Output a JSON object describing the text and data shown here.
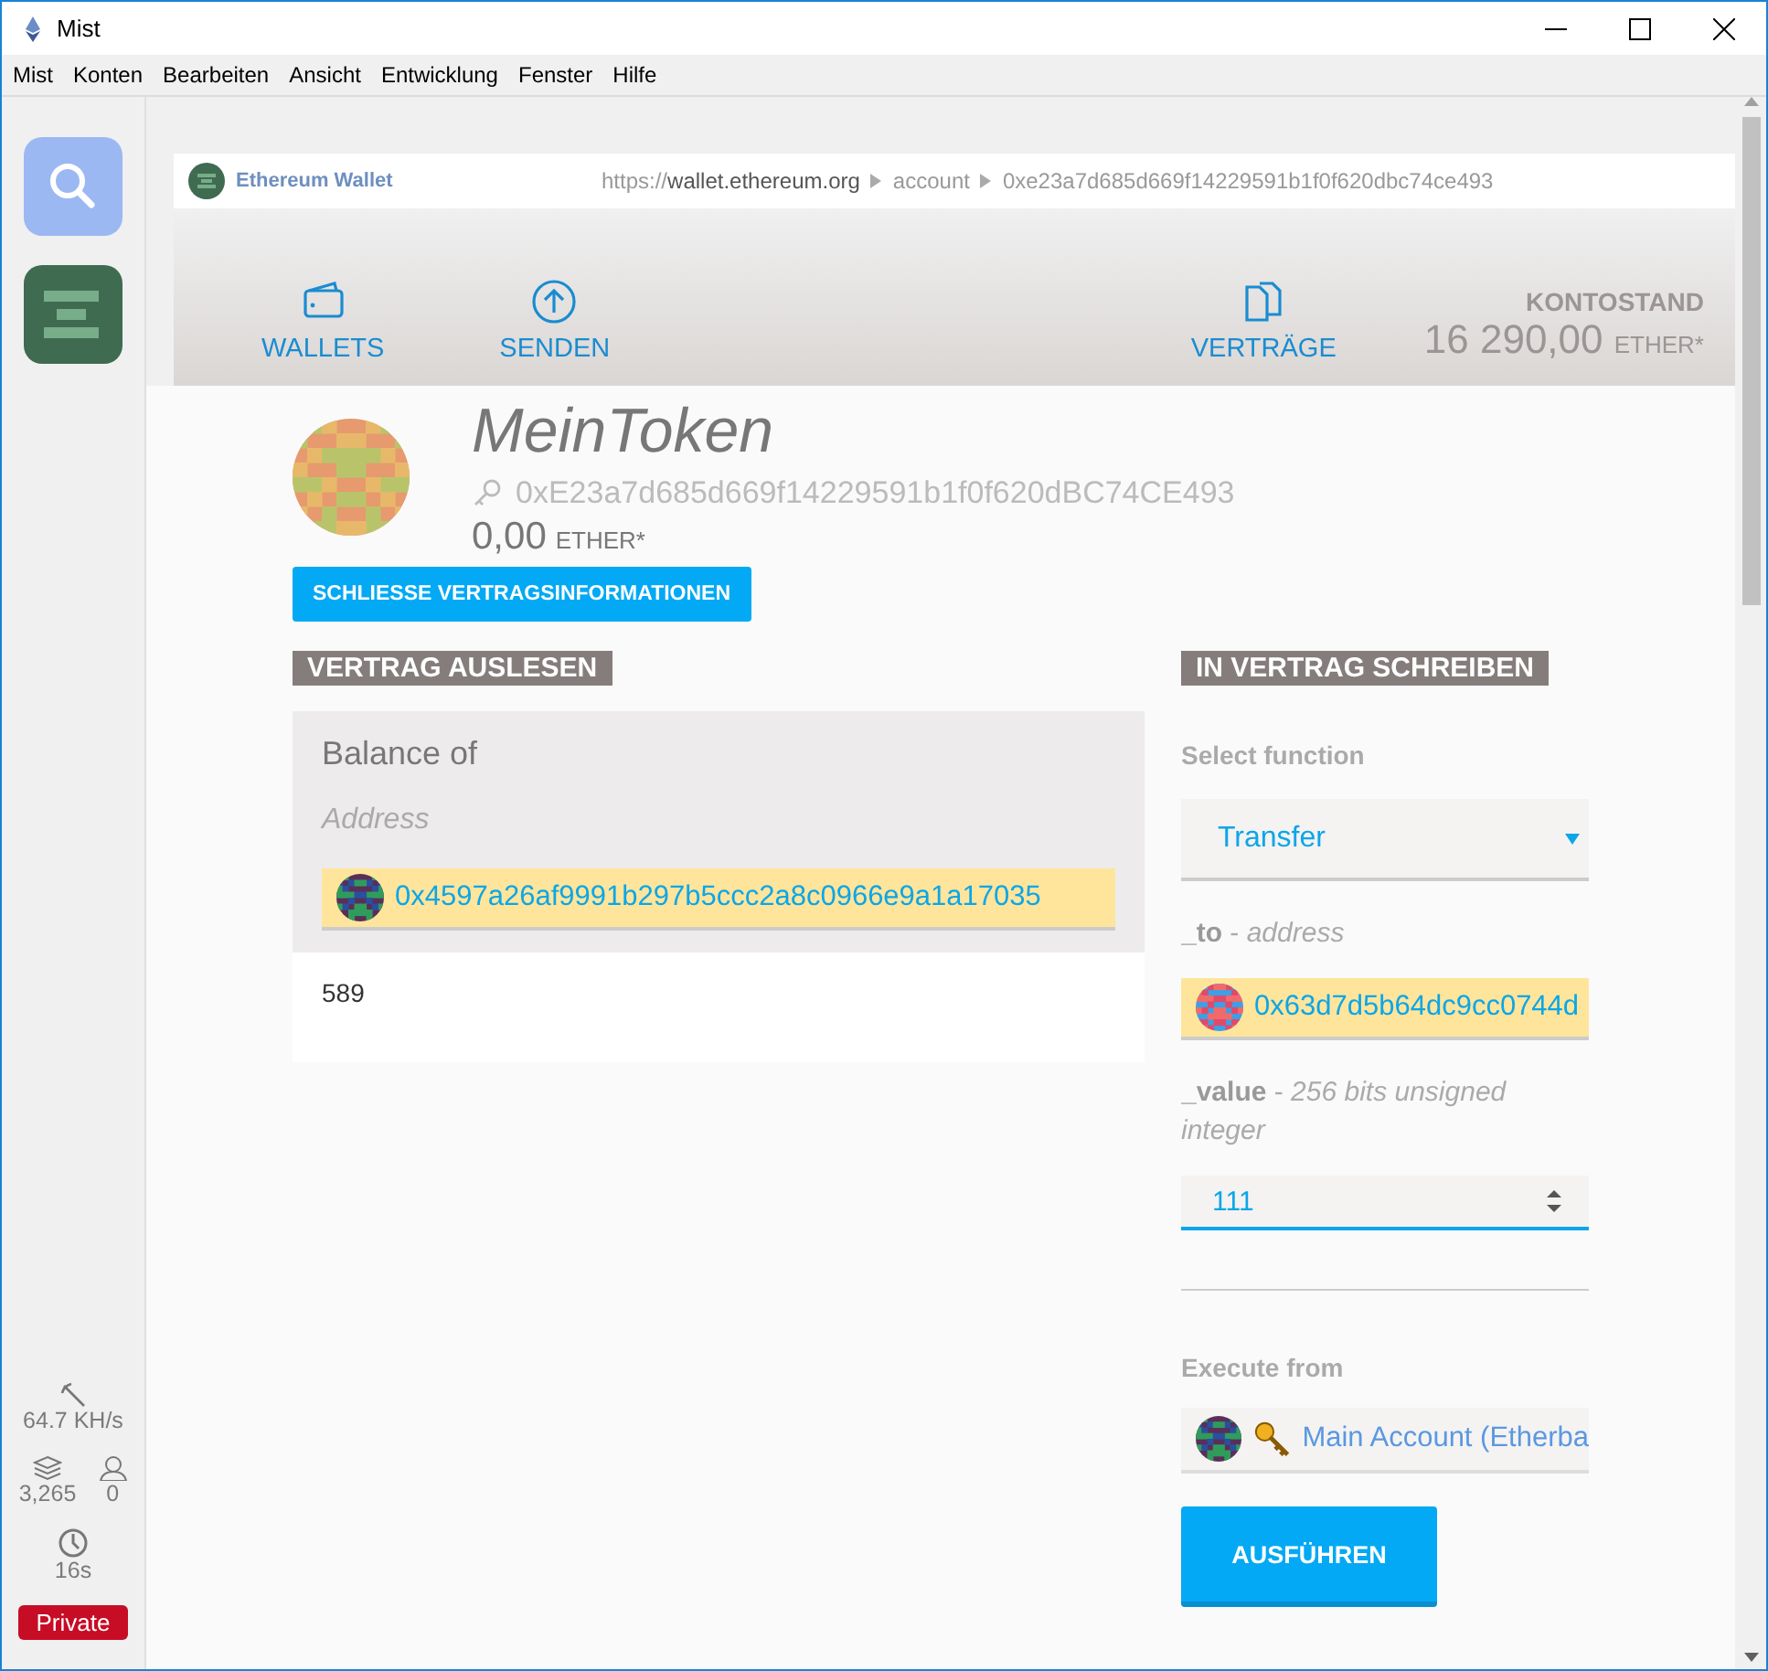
{
  "window": {
    "title": "Mist"
  },
  "menu": [
    "Mist",
    "Konten",
    "Bearbeiten",
    "Ansicht",
    "Entwicklung",
    "Fenster",
    "Hilfe"
  ],
  "sidebar": {
    "apps": [
      {
        "kind": "browser"
      },
      {
        "kind": "wallet"
      }
    ],
    "hashrate": "64.7 KH/s",
    "blocks": "3,265",
    "peers": "0",
    "last_block": "16s",
    "network": "Private"
  },
  "browser_bar": {
    "app_name": "Ethereum Wallet",
    "url_scheme": "https://",
    "url_host": "wallet.ethereum.org",
    "breadcrumbs": [
      "account",
      "0xe23a7d685d669f14229591b1f0f620dbc74ce493"
    ]
  },
  "nav": {
    "items": [
      {
        "label": "WALLETS",
        "kind": "wallet"
      },
      {
        "label": "SENDEN",
        "kind": "send"
      }
    ],
    "right_items": [
      {
        "label": "VERTRÄGE",
        "kind": "contracts"
      }
    ],
    "balance": {
      "label": "KONTOSTAND",
      "amount": "16 290,00",
      "unit": "ETHER*"
    }
  },
  "contract": {
    "name": "MeinToken",
    "address": "0xE23a7d685d669f14229591b1f0f620dBC74CE493",
    "balance": "0,00",
    "unit": "ETHER*",
    "close_button": "SCHLIESSE VERTRAGSINFORMATIONEN"
  },
  "read": {
    "heading": "VERTRAG AUSLESEN",
    "function": "Balance of",
    "param_label": "Address",
    "param_value": "0x4597a26af9991b297b5ccc2a8c0966e9a1a17035",
    "result": "589"
  },
  "write": {
    "heading": "IN VERTRAG SCHREIBEN",
    "select_label": "Select function",
    "selected_function": "Transfer",
    "params": [
      {
        "label": "**_to** - *address*",
        "kind": "address",
        "value": "0x63d7d5b64dc9cc0744d"
      },
      {
        "label": "**_value** - *256 bits unsigned integer*",
        "kind": "number",
        "value": "111"
      }
    ],
    "execute_label": "Execute from",
    "account": "Main Account (Etherba",
    "execute_button": "AUSFÜHREN"
  }
}
